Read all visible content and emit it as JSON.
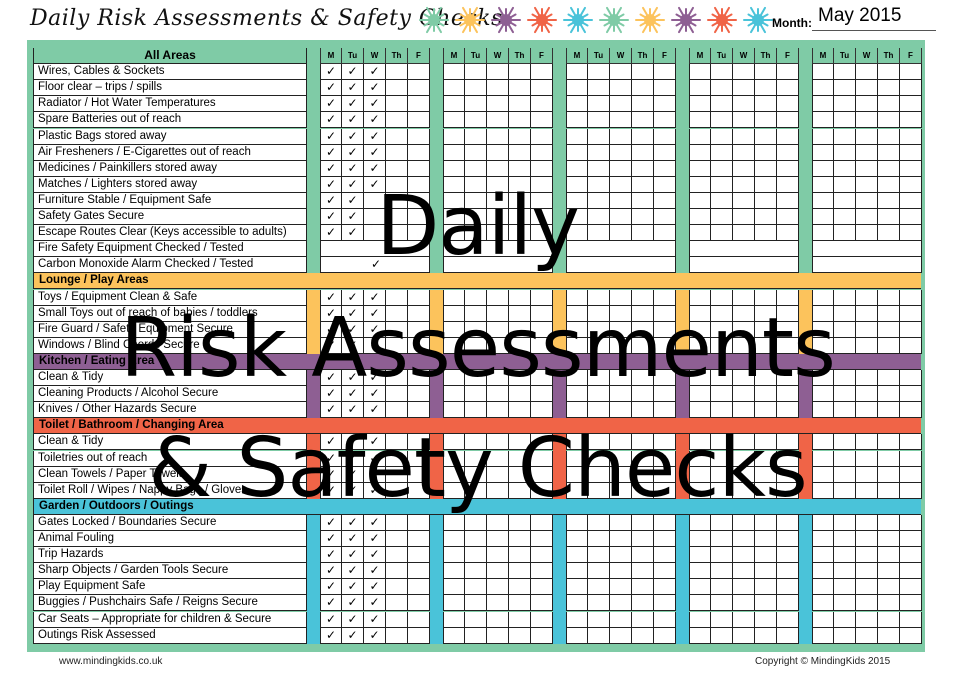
{
  "header": {
    "title": "Daily Risk Assessments & Safety Checks",
    "month_label": "Month:",
    "month_value": "May 2015",
    "sun_icons": [
      "#7fcba6",
      "#fcc35c",
      "#8e5f93",
      "#f06447",
      "#4ac3d9",
      "#7fcba6",
      "#fcc35c",
      "#8e5f93",
      "#f06447",
      "#4ac3d9"
    ]
  },
  "colors": {
    "frame": "#7fcba6",
    "lounge": "#fcc35c",
    "kitchen": "#8e5f93",
    "toilet": "#f06447",
    "garden": "#4ac3d9"
  },
  "table": {
    "header_label": "All Areas",
    "days": [
      "M",
      "Tu",
      "W",
      "Th",
      "F"
    ],
    "weeks": 5,
    "check_glyph": "✓",
    "sections": [
      {
        "name": "All Areas",
        "color_key": "frame",
        "show_header_row": false,
        "items": [
          {
            "label": "Wires, Cables & Sockets",
            "checks": [
              1,
              1,
              1,
              0,
              0
            ]
          },
          {
            "label": "Floor clear – trips / spills",
            "checks": [
              1,
              1,
              1,
              0,
              0
            ]
          },
          {
            "label": "Radiator / Hot Water Temperatures",
            "checks": [
              1,
              1,
              1,
              0,
              0
            ]
          },
          {
            "label": "Spare Batteries out of reach",
            "checks": [
              1,
              1,
              1,
              0,
              0
            ]
          },
          {
            "label": "Plastic Bags stored away",
            "checks": [
              1,
              1,
              1,
              0,
              0
            ]
          },
          {
            "label": "Air Fresheners / E-Cigarettes out of reach",
            "checks": [
              1,
              1,
              1,
              0,
              0
            ]
          },
          {
            "label": "Medicines / Painkillers stored away",
            "checks": [
              1,
              1,
              1,
              0,
              0
            ]
          },
          {
            "label": "Matches / Lighters stored away",
            "checks": [
              1,
              1,
              1,
              0,
              0
            ]
          },
          {
            "label": "Furniture Stable / Equipment Safe",
            "checks": [
              1,
              1,
              0,
              0,
              0
            ]
          },
          {
            "label": "Safety Gates Secure",
            "checks": [
              1,
              1,
              0,
              0,
              0
            ]
          },
          {
            "label": "Escape Routes Clear (Keys accessible to adults)",
            "checks": [
              1,
              1,
              0,
              0,
              0
            ]
          },
          {
            "label": "Fire Safety Equipment Checked / Tested",
            "weekly": true,
            "week1_check": false
          },
          {
            "label": "Carbon Monoxide Alarm Checked / Tested",
            "weekly": true,
            "week1_check": true
          }
        ]
      },
      {
        "name": "Lounge / Play Areas",
        "color_key": "lounge",
        "show_header_row": true,
        "items": [
          {
            "label": "Toys / Equipment Clean & Safe",
            "checks": [
              1,
              1,
              1,
              0,
              0
            ]
          },
          {
            "label": "Small Toys out of reach of babies / toddlers",
            "checks": [
              1,
              1,
              1,
              0,
              0
            ]
          },
          {
            "label": "Fire Guard / Safety Equipment Secure",
            "checks": [
              1,
              1,
              1,
              0,
              0
            ]
          },
          {
            "label": "Windows / Blind Chords Secure",
            "checks": [
              1,
              1,
              1,
              0,
              0
            ]
          }
        ]
      },
      {
        "name": "Kitchen / Eating Area",
        "color_key": "kitchen",
        "show_header_row": true,
        "items": [
          {
            "label": "Clean & Tidy",
            "checks": [
              1,
              1,
              1,
              0,
              0
            ]
          },
          {
            "label": "Cleaning Products / Alcohol Secure",
            "checks": [
              1,
              1,
              1,
              0,
              0
            ]
          },
          {
            "label": "Knives / Other Hazards Secure",
            "checks": [
              1,
              1,
              1,
              0,
              0
            ]
          }
        ]
      },
      {
        "name": "Toilet / Bathroom / Changing Area",
        "color_key": "toilet",
        "show_header_row": true,
        "items": [
          {
            "label": "Clean & Tidy",
            "checks": [
              1,
              1,
              1,
              0,
              0
            ]
          },
          {
            "label": "Toiletries out of reach",
            "checks": [
              1,
              1,
              1,
              0,
              0
            ]
          },
          {
            "label": "Clean Towels / Paper Towels",
            "checks": [
              1,
              1,
              1,
              0,
              0
            ]
          },
          {
            "label": "Toilet Roll / Wipes / Nappy Bags / Gloves",
            "checks": [
              1,
              1,
              1,
              0,
              0
            ]
          }
        ]
      },
      {
        "name": "Garden / Outdoors / Outings",
        "color_key": "garden",
        "show_header_row": true,
        "items": [
          {
            "label": "Gates Locked / Boundaries Secure",
            "checks": [
              1,
              1,
              1,
              0,
              0
            ]
          },
          {
            "label": "Animal Fouling",
            "checks": [
              1,
              1,
              1,
              0,
              0
            ]
          },
          {
            "label": "Trip Hazards",
            "checks": [
              1,
              1,
              1,
              0,
              0
            ]
          },
          {
            "label": "Sharp Objects / Garden Tools Secure",
            "checks": [
              1,
              1,
              1,
              0,
              0
            ]
          },
          {
            "label": "Play Equipment Safe",
            "checks": [
              1,
              1,
              1,
              0,
              0
            ]
          },
          {
            "label": "Buggies / Pushchairs Safe / Reigns Secure",
            "checks": [
              1,
              1,
              1,
              0,
              0
            ]
          },
          {
            "label": "Car Seats – Appropriate for children & Secure",
            "checks": [
              1,
              1,
              1,
              0,
              0
            ]
          },
          {
            "label": "Outings Risk Assessed",
            "checks": [
              1,
              1,
              1,
              0,
              0
            ]
          }
        ]
      }
    ]
  },
  "overlay": {
    "lines": [
      "Daily",
      "Risk Assessments",
      "& Safety Checks"
    ]
  },
  "footer": {
    "website": "www.mindingkids.co.uk",
    "copyright": "Copyright © MindingKids 2015"
  }
}
